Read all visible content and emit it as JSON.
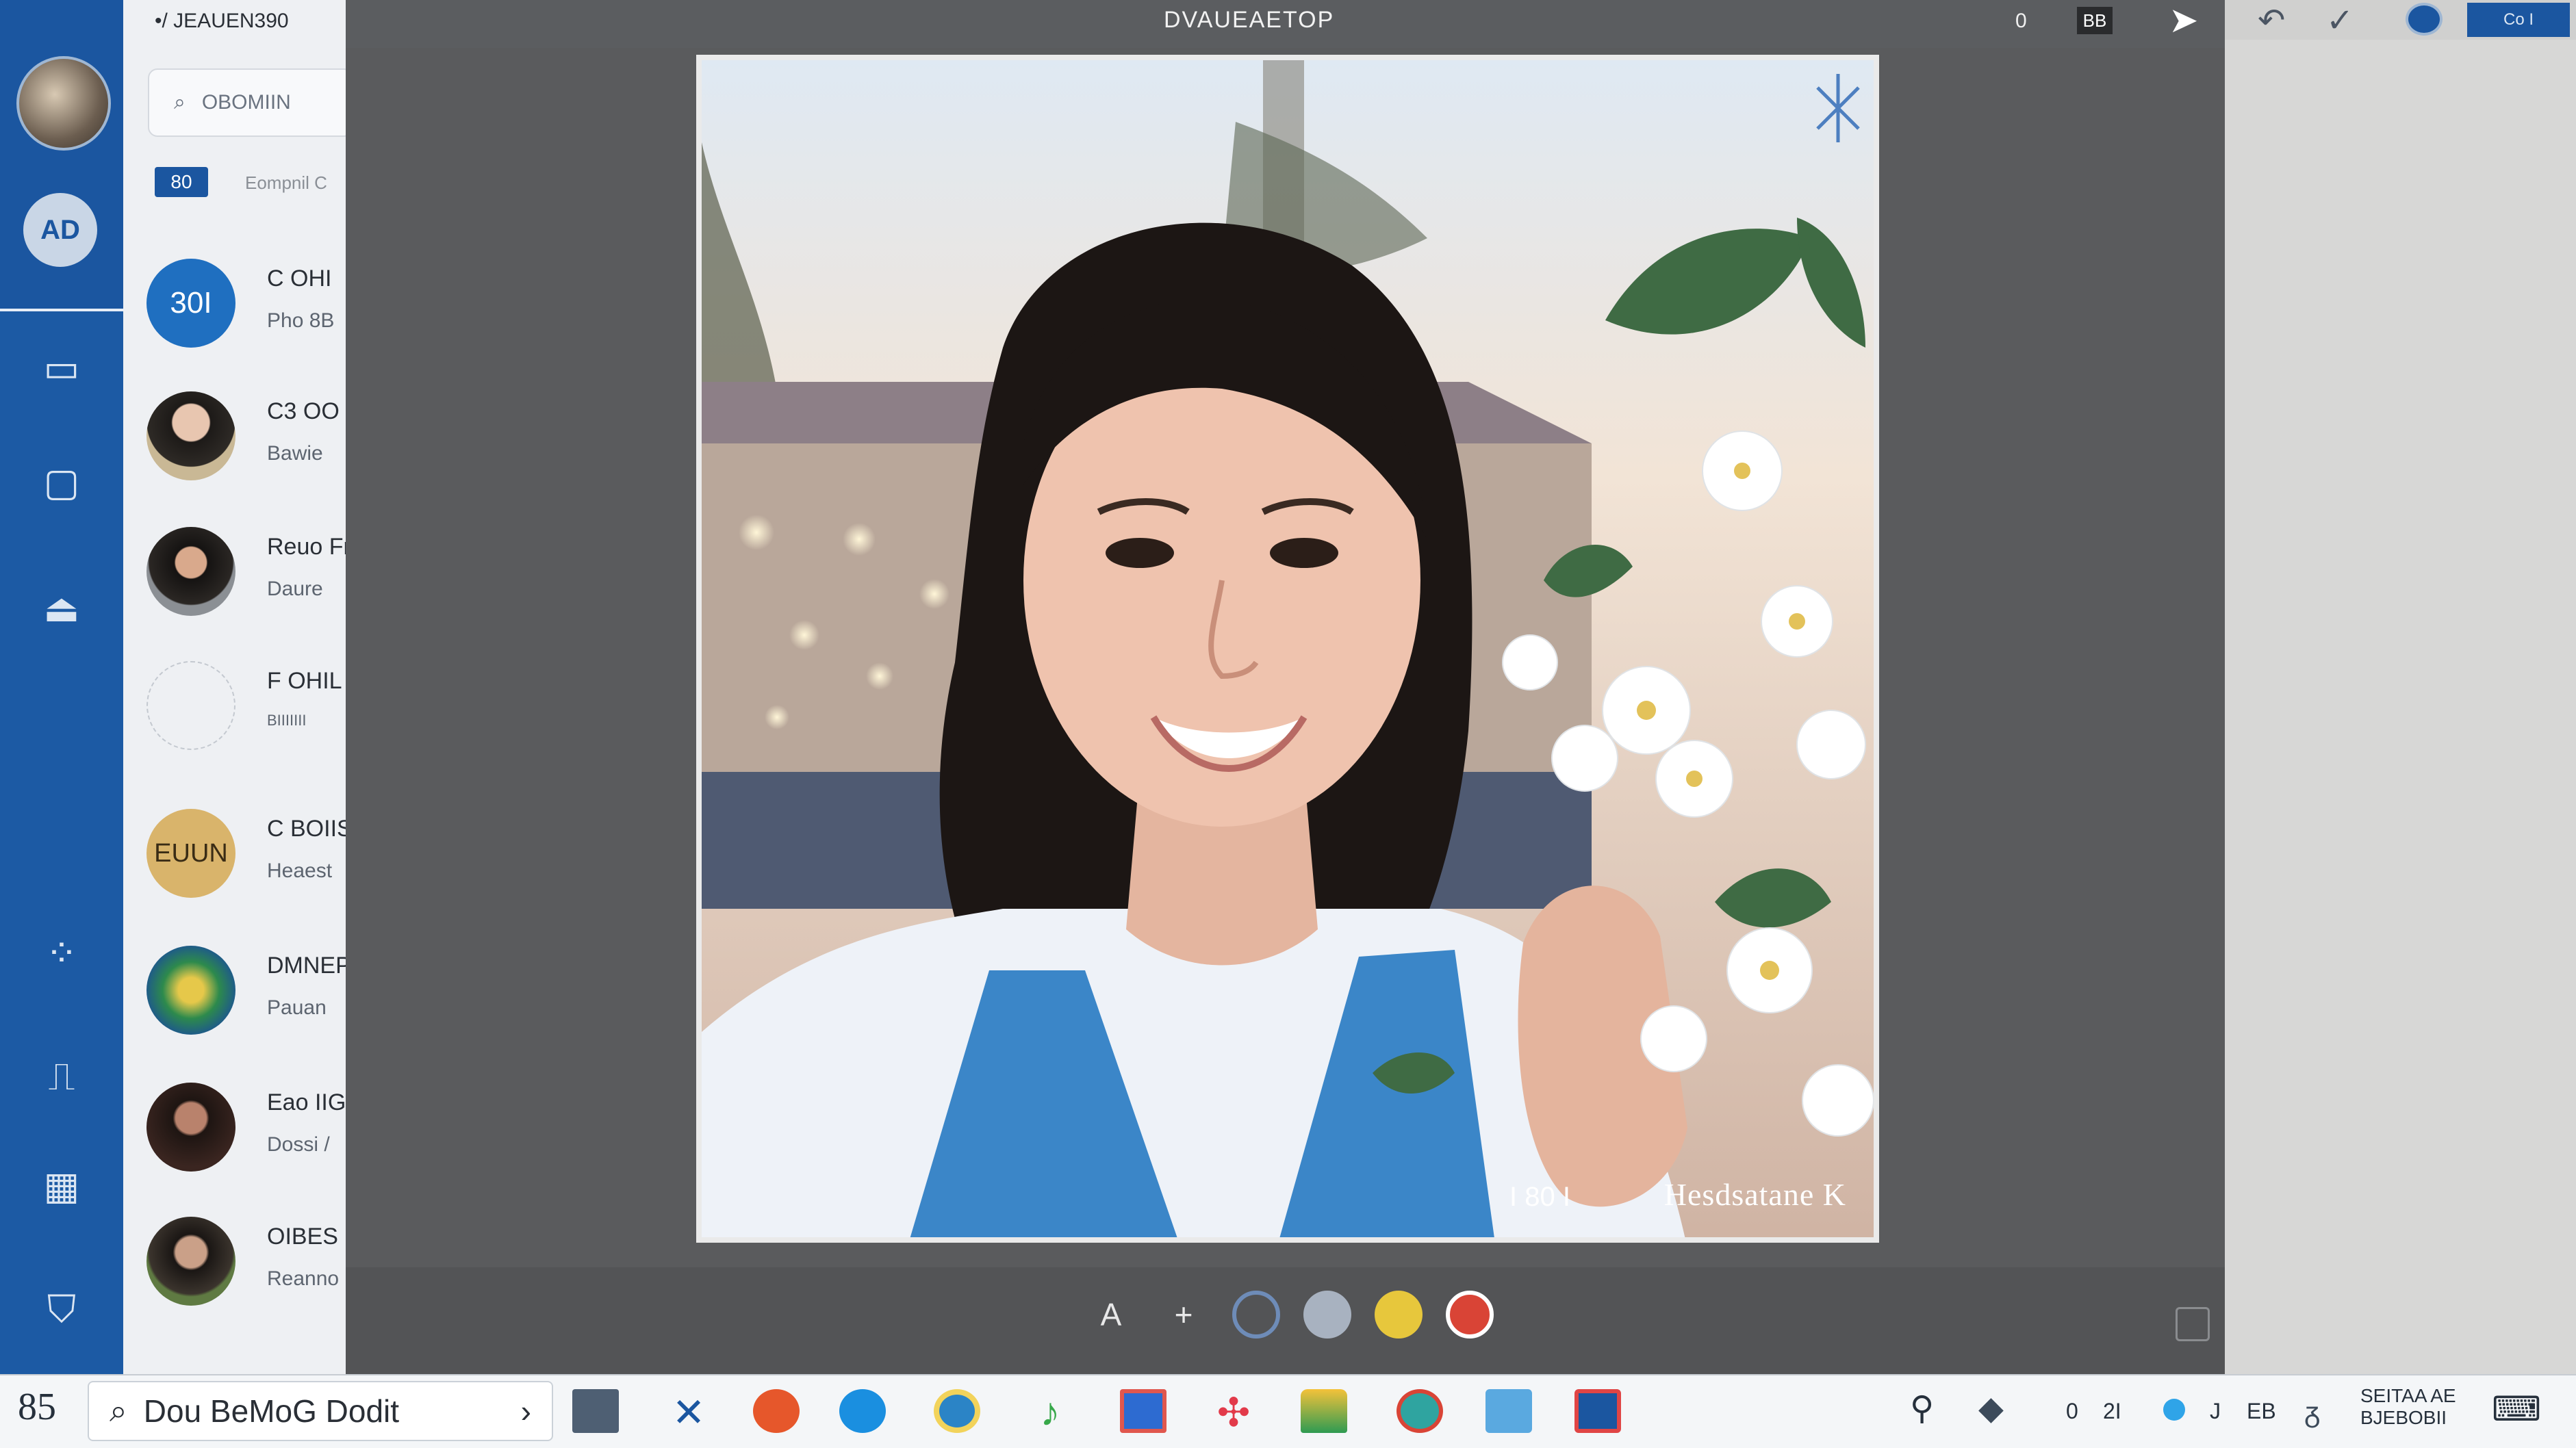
{
  "left_rail": {
    "icons": [
      "avatar",
      "contacts-icon",
      "monitor-icon",
      "window-icon",
      "upload-icon",
      "nodes-icon",
      "graph-icon",
      "calendar-icon",
      "shield-icon"
    ],
    "contacts_label": "AD"
  },
  "header_top_left": "•/ JEAUEN390",
  "chat_list": {
    "search_placeholder": "OBOMIIN",
    "filter_tag": "80",
    "filter_label": "Eompnil C",
    "items": [
      {
        "avatar_text": "30I",
        "title": "C OHI",
        "subtitle": "Pho 8B"
      },
      {
        "avatar_text": "",
        "title": "C3 OO",
        "subtitle": "Bawie"
      },
      {
        "avatar_text": "",
        "title": "Reuo Fr",
        "subtitle": "Daure"
      },
      {
        "avatar_text": "",
        "title": "F OHIL",
        "subtitle": "BIIIIIII"
      },
      {
        "avatar_text": "EUUN",
        "title": "C BOIIS",
        "subtitle": "Heaest"
      },
      {
        "avatar_text": "",
        "title": "DMNEP",
        "subtitle": "Pauan"
      },
      {
        "avatar_text": "",
        "title": "Eao IIG",
        "subtitle": "Dossi /"
      },
      {
        "avatar_text": "",
        "title": "OIBES",
        "subtitle": "Reanno"
      }
    ]
  },
  "topbar": {
    "title": "DVAUEAETOP",
    "items": [
      "0",
      "BB"
    ],
    "right_icons": [
      "undo-icon",
      "check-icon",
      "user-icon"
    ],
    "right_badge": "Co I"
  },
  "photo": {
    "overlay_left": "I 80 I",
    "overlay_right": "Hesdsatane K"
  },
  "bottom_tools": {
    "colors": [
      "#6e8cb8",
      "#a8b2c0",
      "#e7c73c",
      "#d94436"
    ]
  },
  "taskbar": {
    "start": "85",
    "search_text": "Dou BeMoG Dodit",
    "tray_text_1": "SEITAA AE",
    "tray_text_2": "BJEBOBII",
    "tray_items": [
      "0",
      "2I",
      "J",
      "EB"
    ]
  }
}
